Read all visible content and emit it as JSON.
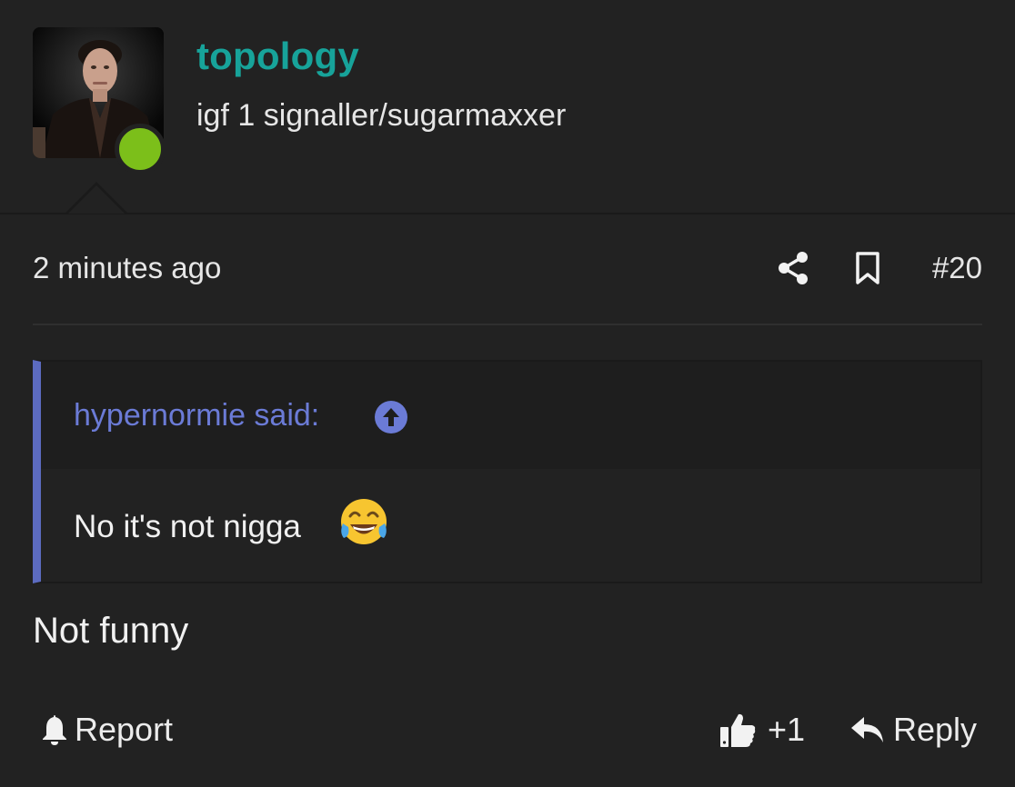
{
  "user": {
    "name": "topology",
    "title": "igf 1 signaller/sugarmaxxer",
    "online": true
  },
  "post": {
    "time": "2 minutes ago",
    "number": "#20",
    "message": "Not funny"
  },
  "quote": {
    "author_label": "hypernormie said:",
    "text": "No it's not nigga"
  },
  "actions": {
    "report_label": "Report",
    "like_count": "+1",
    "reply_label": "Reply"
  },
  "icons": {
    "share": "share-icon",
    "bookmark": "bookmark-icon",
    "quote_jump": "arrow-up-circle-icon",
    "emoji": "tears-of-joy-emoji",
    "report": "bell-icon",
    "like": "thumbs-up-icon",
    "reply": "reply-arrow-icon"
  },
  "colors": {
    "background": "#222222",
    "username": "#17a39a",
    "quote_accent": "#5c6bc0",
    "quote_author": "#6b7bd6",
    "online": "#7cbf1a"
  }
}
